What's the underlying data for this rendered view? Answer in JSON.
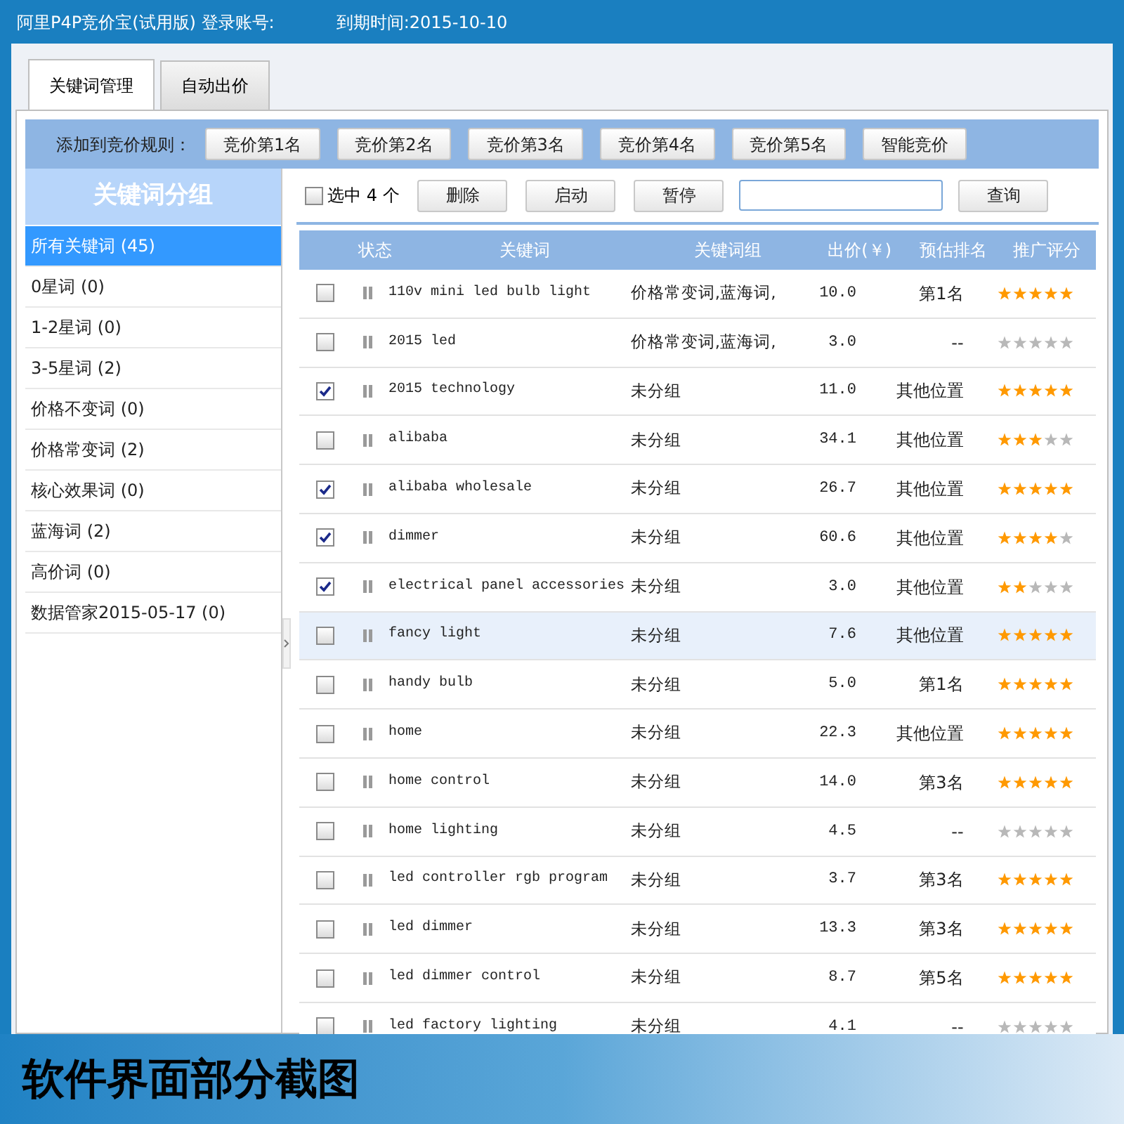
{
  "window": {
    "title": "阿里P4P竞价宝(试用版) 登录账号:",
    "expiry": "到期时间:2015-10-10"
  },
  "tabs": [
    {
      "label": "关键词管理",
      "selected": true
    },
    {
      "label": "自动出价",
      "selected": false
    }
  ],
  "rule_bar": {
    "label": "添加到竞价规则：",
    "buttons": [
      "竞价第1名",
      "竞价第2名",
      "竞价第3名",
      "竞价第4名",
      "竞价第5名",
      "智能竞价"
    ]
  },
  "sidebar": {
    "title": "关键词分组",
    "items": [
      {
        "label": "所有关键词 (45)",
        "selected": true
      },
      {
        "label": "0星词 (0)",
        "selected": false
      },
      {
        "label": "1-2星词 (0)",
        "selected": false
      },
      {
        "label": "3-5星词 (2)",
        "selected": false
      },
      {
        "label": "价格不变词 (0)",
        "selected": false
      },
      {
        "label": "价格常变词 (2)",
        "selected": false
      },
      {
        "label": "核心效果词 (0)",
        "selected": false
      },
      {
        "label": "蓝海词 (2)",
        "selected": false
      },
      {
        "label": "高价词 (0)",
        "selected": false
      },
      {
        "label": "数据管家2015-05-17 (0)",
        "selected": false
      }
    ]
  },
  "toolbar": {
    "select_all": {
      "label": "选中 4 个",
      "checked": false
    },
    "buttons": [
      "删除",
      "启动",
      "暂停"
    ],
    "search_button": "查询"
  },
  "table": {
    "columns": [
      "状态",
      "关键词",
      "关键词组",
      "出价(￥)",
      "预估排名",
      "推广评分"
    ],
    "rows": [
      {
        "checked": false,
        "highlighted": false,
        "keyword": "110v mini led bulb light",
        "group": "价格常变词,蓝海词,",
        "price": "10.0",
        "rank": "第1名",
        "stars": 5
      },
      {
        "checked": false,
        "highlighted": false,
        "keyword": "2015 led",
        "group": "价格常变词,蓝海词,",
        "price": "3.0",
        "rank": "--",
        "stars": 0
      },
      {
        "checked": true,
        "highlighted": false,
        "keyword": "2015 technology",
        "group": "未分组",
        "price": "11.0",
        "rank": "其他位置",
        "stars": 5
      },
      {
        "checked": false,
        "highlighted": false,
        "keyword": "alibaba",
        "group": "未分组",
        "price": "34.1",
        "rank": "其他位置",
        "stars": 3
      },
      {
        "checked": true,
        "highlighted": false,
        "keyword": "alibaba wholesale",
        "group": "未分组",
        "price": "26.7",
        "rank": "其他位置",
        "stars": 5
      },
      {
        "checked": true,
        "highlighted": false,
        "keyword": "dimmer",
        "group": "未分组",
        "price": "60.6",
        "rank": "其他位置",
        "stars": 4
      },
      {
        "checked": true,
        "highlighted": false,
        "keyword": "electrical panel accessories",
        "group": "未分组",
        "price": "3.0",
        "rank": "其他位置",
        "stars": 2
      },
      {
        "checked": false,
        "highlighted": true,
        "keyword": "fancy light",
        "group": "未分组",
        "price": "7.6",
        "rank": "其他位置",
        "stars": 5
      },
      {
        "checked": false,
        "highlighted": false,
        "keyword": "handy bulb",
        "group": "未分组",
        "price": "5.0",
        "rank": "第1名",
        "stars": 5
      },
      {
        "checked": false,
        "highlighted": false,
        "keyword": "home",
        "group": "未分组",
        "price": "22.3",
        "rank": "其他位置",
        "stars": 5
      },
      {
        "checked": false,
        "highlighted": false,
        "keyword": "home control",
        "group": "未分组",
        "price": "14.0",
        "rank": "第3名",
        "stars": 5
      },
      {
        "checked": false,
        "highlighted": false,
        "keyword": "home lighting",
        "group": "未分组",
        "price": "4.5",
        "rank": "--",
        "stars": 0
      },
      {
        "checked": false,
        "highlighted": false,
        "keyword": "led controller rgb program",
        "group": "未分组",
        "price": "3.7",
        "rank": "第3名",
        "stars": 5
      },
      {
        "checked": false,
        "highlighted": false,
        "keyword": "led dimmer",
        "group": "未分组",
        "price": "13.3",
        "rank": "第3名",
        "stars": 5
      },
      {
        "checked": false,
        "highlighted": false,
        "keyword": "led dimmer control",
        "group": "未分组",
        "price": "8.7",
        "rank": "第5名",
        "stars": 5
      },
      {
        "checked": false,
        "highlighted": false,
        "keyword": "led factory lighting",
        "group": "未分组",
        "price": "4.1",
        "rank": "--",
        "stars": 0
      }
    ]
  },
  "caption": "软件界面部分截图"
}
